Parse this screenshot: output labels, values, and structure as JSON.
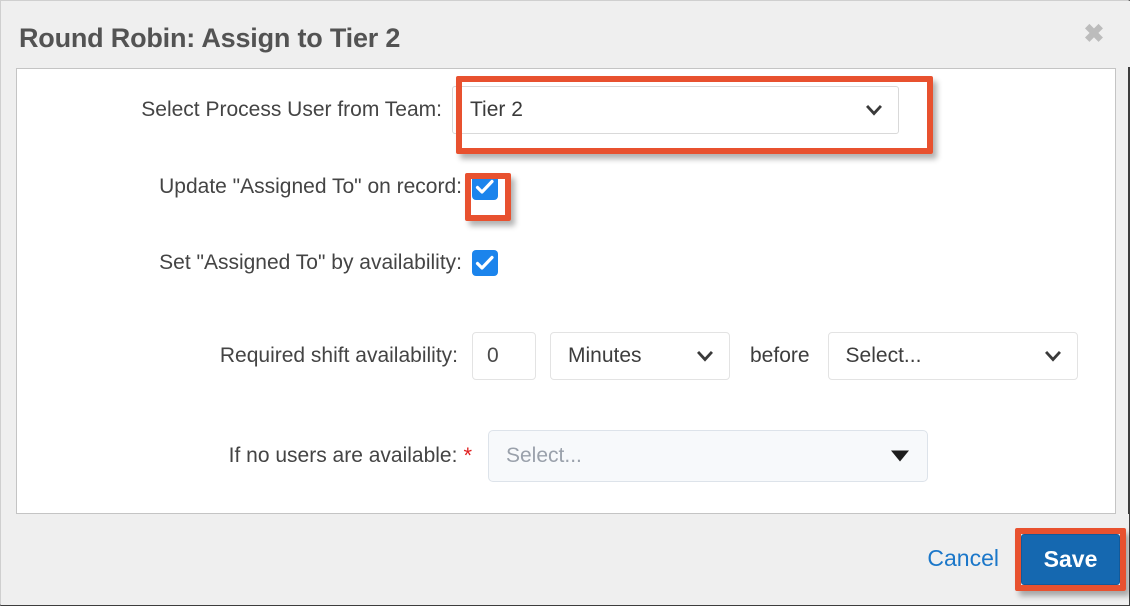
{
  "modal": {
    "title": "Round Robin: Assign to Tier 2",
    "close_icon": "close-icon"
  },
  "form": {
    "team": {
      "label": "Select Process User from Team:",
      "value": "Tier 2",
      "icon": "chevron-down-icon"
    },
    "update_assigned": {
      "label": "Update \"Assigned To\" on record:",
      "checked": true
    },
    "set_by_availability": {
      "label": "Set \"Assigned To\" by availability:",
      "checked": true
    },
    "shift": {
      "label": "Required shift availability:",
      "amount": "0",
      "unit": "Minutes",
      "unit_icon": "chevron-down-icon",
      "conjunction": "before",
      "reference": "Select...",
      "reference_icon": "chevron-down-icon"
    },
    "no_users": {
      "label": "If no users are available:",
      "required_marker": "*",
      "placeholder": "Select...",
      "icon": "caret-down-icon"
    }
  },
  "footer": {
    "cancel_label": "Cancel",
    "save_label": "Save"
  },
  "colors": {
    "annotation_red": "#e8512f",
    "checkbox_blue": "#1b84ec",
    "save_blue": "#1568b0",
    "link_blue": "#1b77c9",
    "required_red": "#e02020"
  }
}
